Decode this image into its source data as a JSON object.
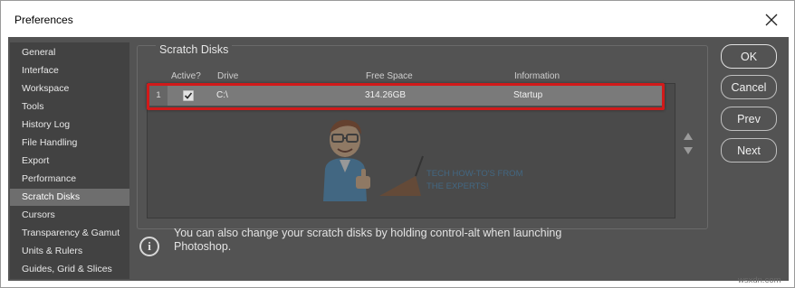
{
  "window": {
    "title": "Preferences"
  },
  "sidebar": {
    "items": [
      {
        "label": "General"
      },
      {
        "label": "Interface"
      },
      {
        "label": "Workspace"
      },
      {
        "label": "Tools"
      },
      {
        "label": "History Log"
      },
      {
        "label": "File Handling"
      },
      {
        "label": "Export"
      },
      {
        "label": "Performance"
      },
      {
        "label": "Scratch Disks",
        "selected": true
      },
      {
        "label": "Cursors"
      },
      {
        "label": "Transparency & Gamut"
      },
      {
        "label": "Units & Rulers"
      },
      {
        "label": "Guides, Grid & Slices"
      }
    ]
  },
  "scratch": {
    "section_title": "Scratch Disks",
    "columns": {
      "active": "Active?",
      "drive": "Drive",
      "free_space": "Free Space",
      "information": "Information"
    },
    "rows": [
      {
        "num": "1",
        "active": true,
        "drive": "C:\\",
        "free_space": "314.26GB",
        "information": "Startup"
      }
    ],
    "info_text": "You can also change your scratch disks by holding control-alt when launching Photoshop."
  },
  "buttons": {
    "ok": "OK",
    "cancel": "Cancel",
    "prev": "Prev",
    "next": "Next"
  },
  "watermark": {
    "tagline_1": "TECH HOW-TO'S FROM",
    "tagline_2": "THE EXPERTS!"
  },
  "site": "wsxdn.com",
  "colors": {
    "highlight": "#d11a1a",
    "panel_bg": "#535353",
    "sidebar_bg": "#424242",
    "selected_bg": "#6e6e6e"
  }
}
